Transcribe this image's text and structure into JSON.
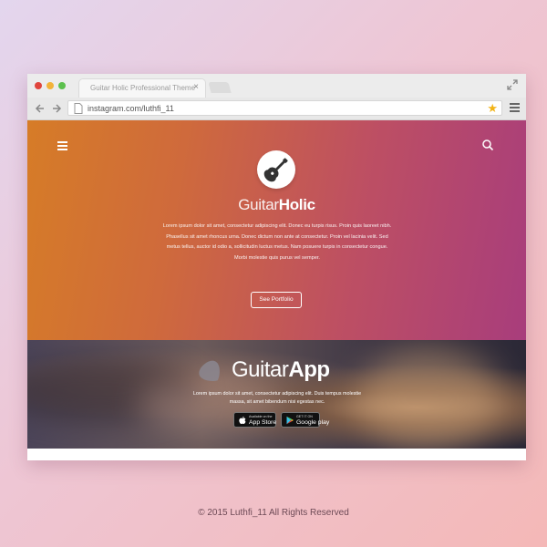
{
  "browser": {
    "tab_title": "Guitar Holic Professional Theme",
    "tab_close": "×",
    "url": "instagram.com/luthfi_11",
    "star_glyph": "★"
  },
  "hero": {
    "brand_light": "Guitar",
    "brand_bold": "Holic",
    "paragraph": "Lorem ipsum dolor sit amet, consectetur adipiscing elit. Donec eu turpis risus. Proin quis laoreet nibh. Phasellus sit amet rhoncus urna. Donec dictum non ante at consectetur. Proin vel lacinia velit. Sed metus tellus, auctor id odio a, sollicitudin luctus metus. Nam posuere turpis in consectetur congue. Morbi molestie quis purus vel semper.",
    "cta_label": "See Portfolio",
    "colors": {
      "gradient_start": "#d67c27",
      "gradient_end": "#a83d7c"
    }
  },
  "app": {
    "title_light": "Guitar",
    "title_bold": "App",
    "paragraph": "Lorem ipsum dolor sit amet, consectetur adipiscing elit. Duis tempus molestie massa, sit amet bibendum nisi egestas nec.",
    "appstore_small": "Available on the",
    "appstore_big": "App Store",
    "googleplay_small": "GET IT ON",
    "googleplay_big": "Google play"
  },
  "footer": {
    "copyright": "© 2015 Luthfi_11 All Rights Reserved"
  },
  "icons": [
    "close-icon",
    "expand-icon",
    "back-arrow-icon",
    "forward-arrow-icon",
    "page-icon",
    "star-icon",
    "menu-icon",
    "search-icon",
    "guitar-icon",
    "guitar-pick-icon",
    "apple-icon",
    "google-play-icon"
  ]
}
